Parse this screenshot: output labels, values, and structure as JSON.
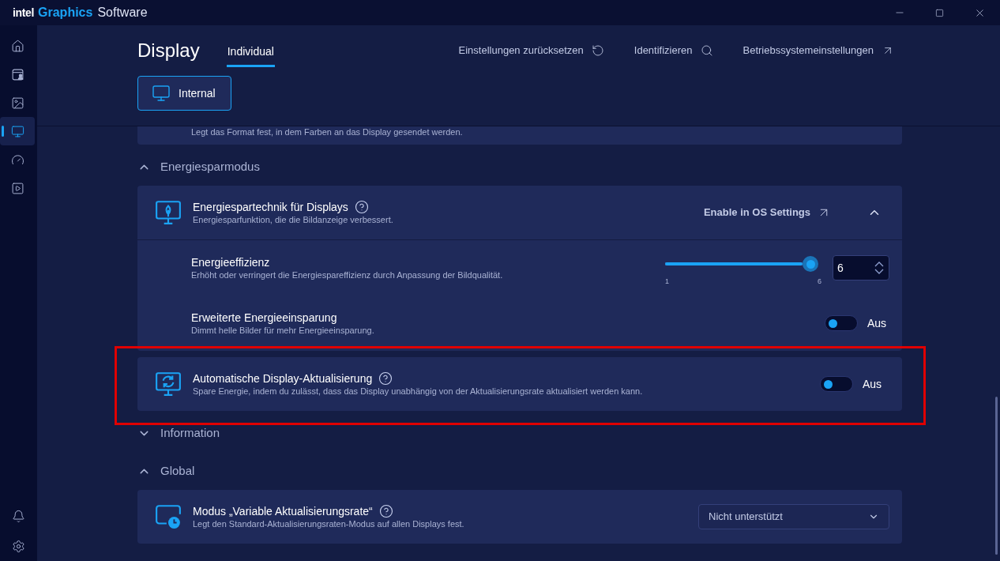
{
  "app": {
    "brand_mark": "intel",
    "title_accent": "Graphics",
    "title": "Software"
  },
  "sidebar": {
    "items": [
      {
        "selected": false
      },
      {
        "selected": false
      },
      {
        "selected": false
      },
      {
        "selected": true
      },
      {
        "selected": false
      },
      {
        "selected": false
      }
    ]
  },
  "page": {
    "title": "Display",
    "tabs": [
      {
        "label": "Individual",
        "selected": true
      }
    ],
    "actions": [
      {
        "label": "Einstellungen zurücksetzen",
        "kind": "reset"
      },
      {
        "label": "Identifizieren",
        "kind": "search"
      },
      {
        "label": "Betriebssystemeinstellungen",
        "kind": "external"
      }
    ],
    "displays": [
      {
        "label": "Internal",
        "selected": true
      }
    ]
  },
  "partial_card": {
    "description": "Legt das Format fest, in dem Farben an das Display gesendet werden."
  },
  "sections": [
    {
      "title": "Energiesparmodus",
      "expanded": true,
      "cards": [
        {
          "kind": "expandable",
          "title": "Energiespartechnik für Displays",
          "help": true,
          "description": "Energiesparfunktion, die die Bildanzeige verbessert.",
          "link": "Enable in OS Settings",
          "expanded": true,
          "highlighted": false,
          "children": [
            {
              "kind": "slider",
              "title": "Energieeffizienz",
              "description": "Erhöht oder verringert die Energiespareffizienz durch Anpassung der Bildqualität.",
              "level": 1,
              "min_label": "1",
              "max_label": "6",
              "value": "6"
            },
            {
              "kind": "toggle",
              "title": "Erweiterte Energieeinsparung",
              "description": "Dimmt helle Bilder für mehr Energieeinsparung.",
              "on": false,
              "state_label": "Aus"
            }
          ]
        },
        {
          "kind": "toggle",
          "title": "Automatische Display-Aktualisierung",
          "help": true,
          "description": "Spare Energie, indem du zulässt, dass das Display unabhängig von der Aktualisierungsrate aktualisiert werden kann.",
          "on": false,
          "state_label": "Aus",
          "highlighted": true
        }
      ]
    },
    {
      "title": "Information",
      "expanded": false
    },
    {
      "title": "Global",
      "expanded": true,
      "cards": [
        {
          "kind": "dropdown",
          "title": "Modus „Variable Aktualisierungsrate“",
          "help": true,
          "description": "Legt den Standard-Aktualisierungsraten-Modus auf allen Displays fest.",
          "value": "Nicht unterstützt",
          "highlighted": false
        }
      ]
    }
  ]
}
